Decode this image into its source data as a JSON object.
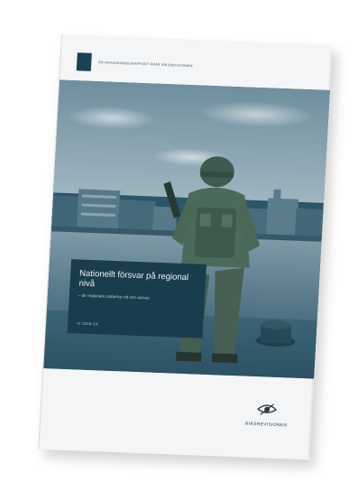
{
  "report": {
    "header_text": "EN GRANSKNINGSRAPPORT FRÅN RIKSREVISIONEN",
    "title": "Nationellt försvar på regional nivå",
    "subtitle": "– de regionala staberna vid och ansvar",
    "report_number": "rir 2018:14"
  },
  "publisher": {
    "name": "RIKSREVISIONEN",
    "logo_icon": "eye-logo-icon"
  },
  "colors": {
    "cover_background": "#f4f5f6",
    "title_box": "#1a3d4d",
    "photo_tint": "#2b5568"
  }
}
